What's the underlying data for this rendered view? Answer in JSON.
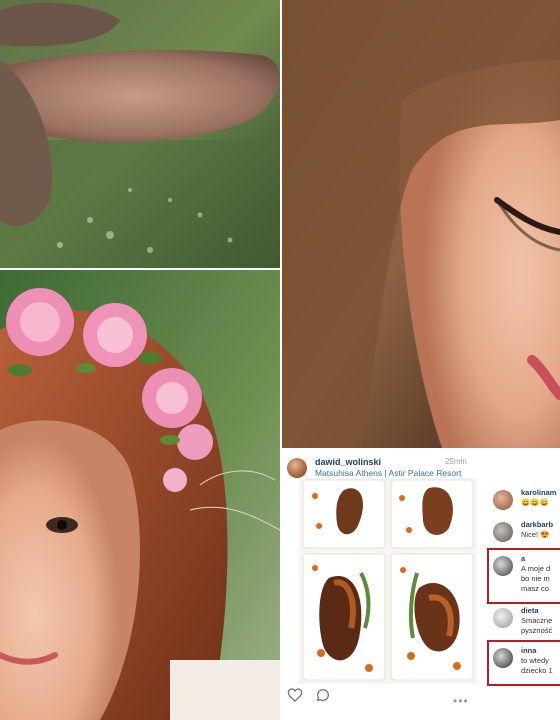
{
  "post": {
    "username": "dawid_wolinski",
    "time": "25min",
    "location": "Matsuhisa Athens | Astir Palace Resort",
    "comments": [
      {
        "name": "karolinam",
        "text": "😀😀😀"
      },
      {
        "name": "darkbarb",
        "text": "Nice! 😍"
      },
      {
        "name": "a",
        "text": "A moje d",
        "text2": "bo nie m",
        "text3": "masz co",
        "highlighted": true
      },
      {
        "name": "dieta",
        "text": "Smaczne",
        "text2": "pyszność"
      },
      {
        "name": "inna",
        "text": "to wtedy",
        "text2": "dziecko 1",
        "highlighted": true
      }
    ]
  },
  "icons": [
    "heart-icon",
    "comment-icon",
    "more-icon"
  ]
}
